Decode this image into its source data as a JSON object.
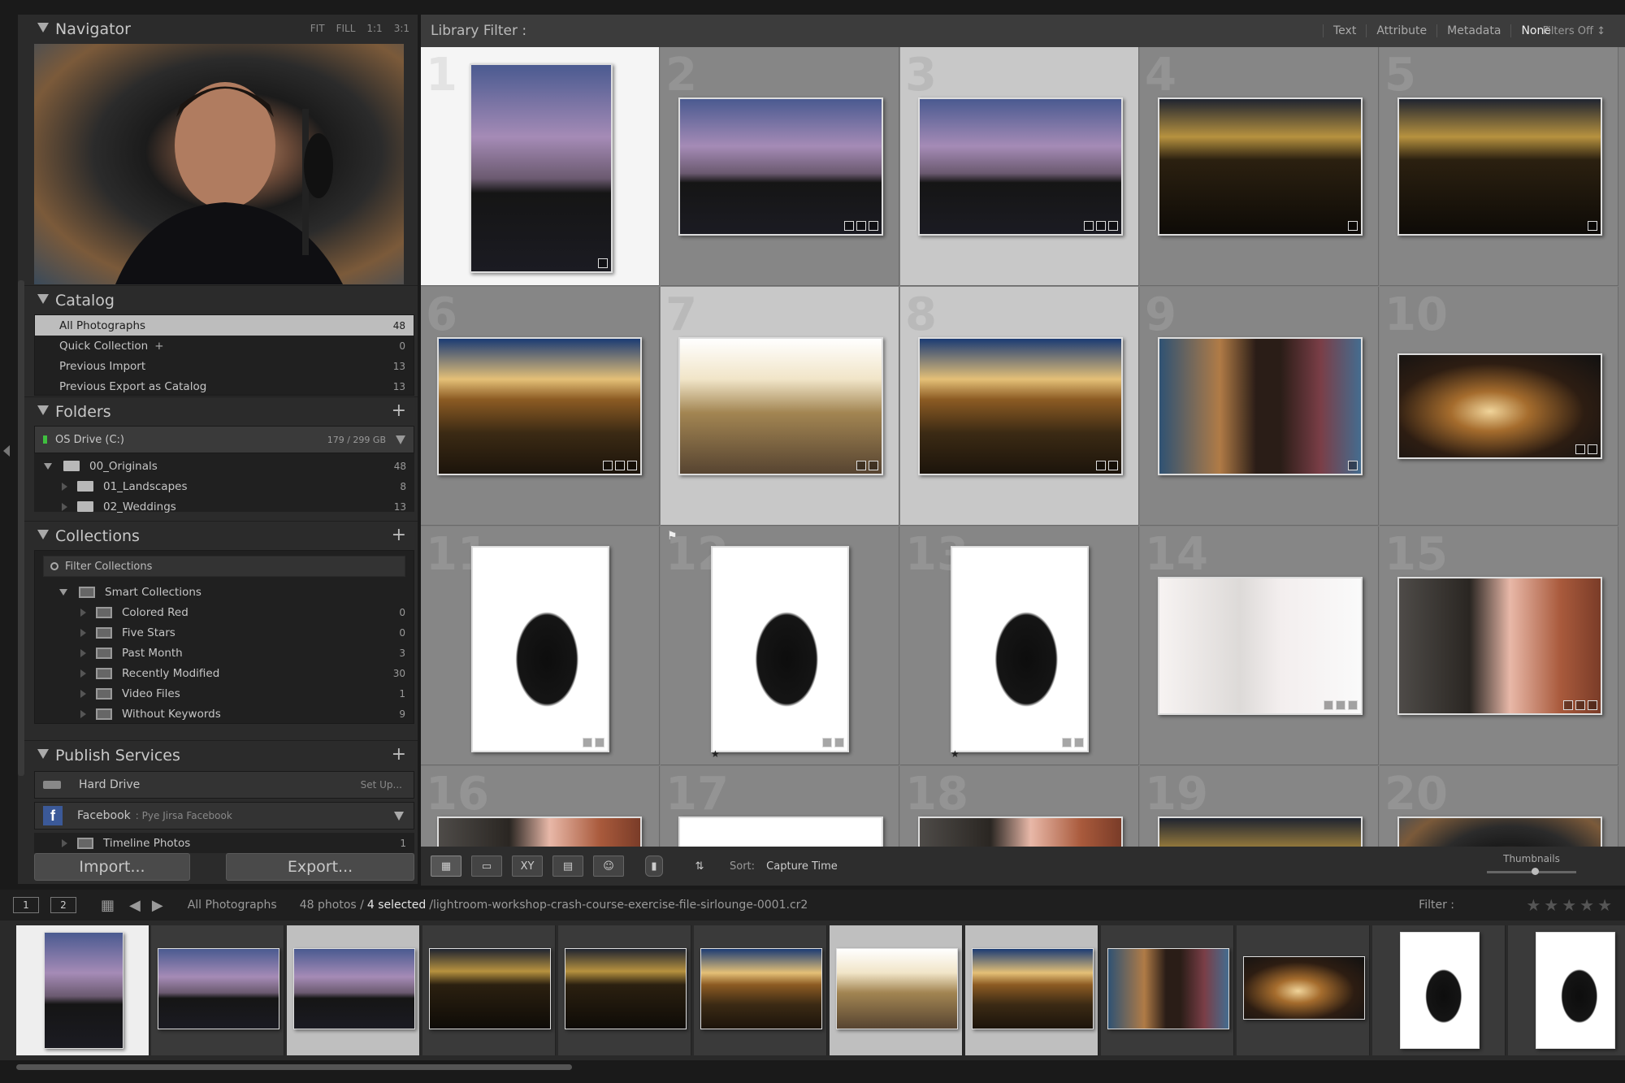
{
  "navigator": {
    "title": "Navigator",
    "zoom": [
      "FIT",
      "FILL",
      "1:1",
      "3:1"
    ]
  },
  "catalog": {
    "title": "Catalog",
    "items": [
      {
        "label": "All Photographs",
        "count": "48"
      },
      {
        "label": "Quick Collection",
        "plus": "+",
        "count": "0"
      },
      {
        "label": "Previous Import",
        "count": "13"
      },
      {
        "label": "Previous Export as Catalog",
        "count": "13"
      }
    ]
  },
  "folders": {
    "title": "Folders",
    "plus": "+",
    "drive": {
      "label": "OS Drive (C:)",
      "size": "179 / 299 GB"
    },
    "items": [
      {
        "label": "00_Originals",
        "count": "48"
      },
      {
        "label": "01_Landscapes",
        "count": "8"
      },
      {
        "label": "02_Weddings",
        "count": "13"
      }
    ]
  },
  "collections": {
    "title": "Collections",
    "plus": "+",
    "filter_label": "Filter Collections",
    "group": "Smart Collections",
    "items": [
      {
        "label": "Colored Red",
        "count": "0"
      },
      {
        "label": "Five Stars",
        "count": "0"
      },
      {
        "label": "Past Month",
        "count": "3"
      },
      {
        "label": "Recently Modified",
        "count": "30"
      },
      {
        "label": "Video Files",
        "count": "1"
      },
      {
        "label": "Without Keywords",
        "count": "9"
      }
    ]
  },
  "publish": {
    "title": "Publish Services",
    "plus": "+",
    "hard_drive": "Hard Drive",
    "setup": "Set Up...",
    "facebook": "Facebook",
    "facebook_sub": ": Pye Jirsa Facebook",
    "timeline": "Timeline Photos",
    "timeline_count": "1"
  },
  "buttons": {
    "import": "Import...",
    "export": "Export..."
  },
  "library_filter": {
    "label": "Library Filter :",
    "options": [
      "Text",
      "Attribute",
      "Metadata",
      "None"
    ],
    "active": "None",
    "filters_off": "Filters Off ↕"
  },
  "grid": {
    "numbers": [
      "1",
      "2",
      "3",
      "4",
      "5",
      "6",
      "7",
      "8",
      "9",
      "10",
      "11",
      "12",
      "13",
      "14",
      "15",
      "16",
      "17",
      "18",
      "19",
      "20"
    ]
  },
  "toolbar": {
    "sort_label": "Sort:",
    "sort_value": "Capture Time",
    "thumbnails_label": "Thumbnails",
    "xy": "XY"
  },
  "filmstrip": {
    "screens": [
      "1",
      "2"
    ],
    "source": "All Photographs",
    "count": "48 photos /",
    "selected": "4 selected",
    "file": "/lightroom-workshop-crash-course-exercise-file-sirlounge-0001.cr2",
    "filter_label": "Filter :",
    "stars": "★★★★★"
  }
}
